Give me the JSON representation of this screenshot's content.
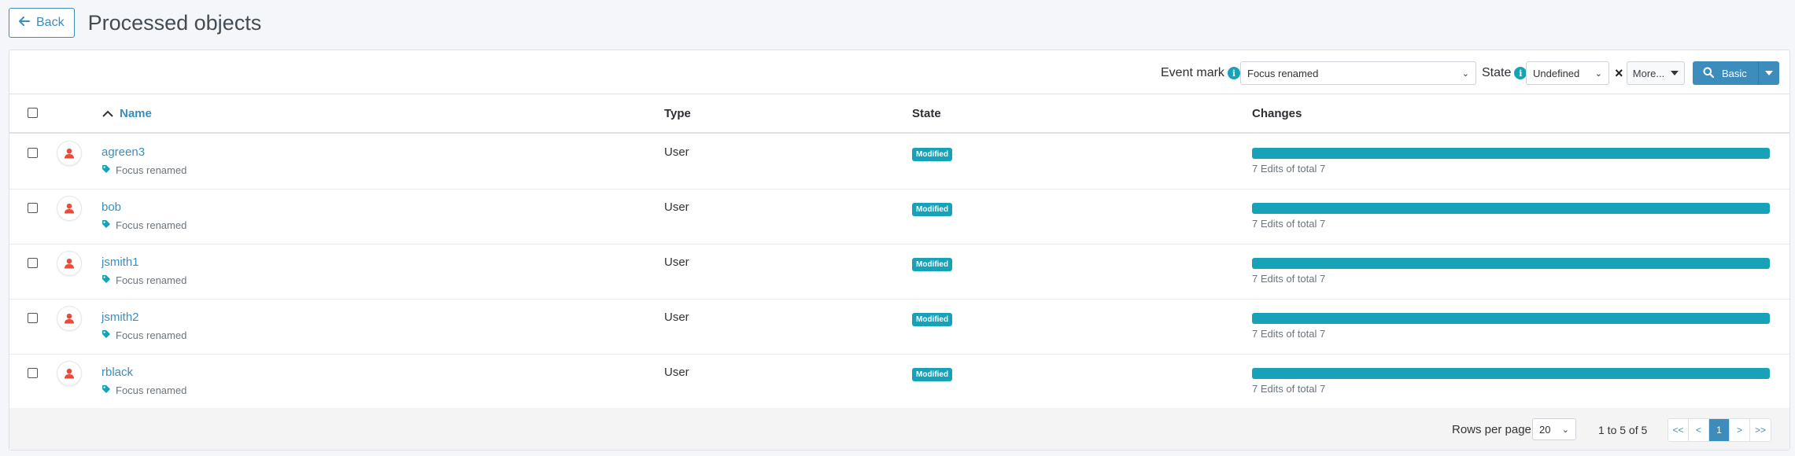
{
  "header": {
    "back_label": "Back",
    "title": "Processed objects"
  },
  "toolbar": {
    "event_mark_label": "Event mark",
    "event_mark_value": "Focus renamed",
    "state_label": "State",
    "state_value": "Undefined",
    "more_label": "More...",
    "basic_label": "Basic"
  },
  "table": {
    "columns": {
      "name": "Name",
      "type": "Type",
      "state": "State",
      "changes": "Changes"
    },
    "rows": [
      {
        "name": "agreen3",
        "mark": "Focus renamed",
        "type": "User",
        "state": "Modified",
        "changes_text": "7 Edits of total 7",
        "progress": 1.0
      },
      {
        "name": "bob",
        "mark": "Focus renamed",
        "type": "User",
        "state": "Modified",
        "changes_text": "7 Edits of total 7",
        "progress": 1.0
      },
      {
        "name": "jsmith1",
        "mark": "Focus renamed",
        "type": "User",
        "state": "Modified",
        "changes_text": "7 Edits of total 7",
        "progress": 1.0
      },
      {
        "name": "jsmith2",
        "mark": "Focus renamed",
        "type": "User",
        "state": "Modified",
        "changes_text": "7 Edits of total 7",
        "progress": 1.0
      },
      {
        "name": "rblack",
        "mark": "Focus renamed",
        "type": "User",
        "state": "Modified",
        "changes_text": "7 Edits of total 7",
        "progress": 1.0
      }
    ]
  },
  "footer": {
    "rows_per_page_label": "Rows per page",
    "rows_per_page_value": "20",
    "range_text": "1 to 5 of 5",
    "pager": {
      "first": "<<",
      "prev": "<",
      "current": "1",
      "next": ">",
      "last": ">>"
    }
  },
  "colors": {
    "primary": "#3c8dbc",
    "info": "#17a2b8",
    "avatar_icon": "#e74c3c"
  },
  "icons": {
    "back": "arrow-left-icon",
    "info": "info-icon",
    "search": "search-icon",
    "tag": "tag-icon",
    "user": "user-icon",
    "sort": "chevron-up-icon"
  }
}
